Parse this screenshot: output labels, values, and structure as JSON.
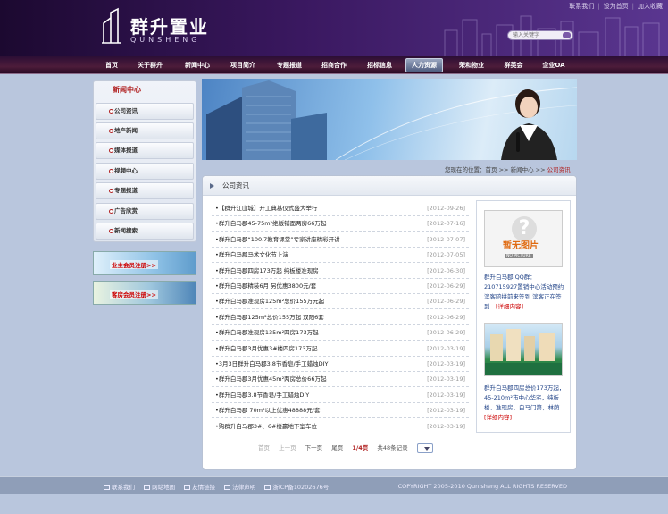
{
  "header": {
    "brand_cn": "群升置业",
    "brand_en": "QUNSHENG",
    "top_links": [
      "联系我们",
      "设为首页",
      "加入收藏"
    ],
    "search_placeholder": "输入关键字"
  },
  "nav": {
    "items": [
      "首页",
      "关于群升",
      "新闻中心",
      "项目简介",
      "专题报道",
      "招商合作",
      "招标信息",
      "人力资源",
      "荣和物业",
      "群英会",
      "企业OA"
    ],
    "active_index": 7
  },
  "sidebar": {
    "title": "新闻中心",
    "items": [
      "公司资讯",
      "地产新闻",
      "媒体报道",
      "视频中心",
      "专题报道",
      "广告欣赏",
      "新闻搜索"
    ]
  },
  "banners": [
    "业主会员注册>>",
    "客房会员注册>>"
  ],
  "breadcrumb": {
    "prefix": "您现在的位置：",
    "home": "首页",
    "sep": ">>",
    "section": "新闻中心",
    "current": "公司资讯"
  },
  "panel": {
    "title": "公司资讯",
    "news": [
      {
        "title": "•【群升江山城】开工典基仪式盛大举行",
        "date": "[2012-09-26]"
      },
      {
        "title": "•群升白马郡45-75m²绝版铺面两房66万起",
        "date": "[2012-07-16]"
      },
      {
        "title": "•群升白马郡“100.7教育课堂”专家讲座精彩开讲",
        "date": "[2012-07-07]"
      },
      {
        "title": "•群升白马郡马术文化节上演",
        "date": "[2012-07-05]"
      },
      {
        "title": "•群升白马郡四房173万起 纯板楼准现房",
        "date": "[2012-06-30]"
      },
      {
        "title": "•群升白马郡精装6月 另优惠3800元/套",
        "date": "[2012-06-29]"
      },
      {
        "title": "•群升白马郡准现房125m²总价155万元起",
        "date": "[2012-06-29]"
      },
      {
        "title": "•群升白马郡125m²总价155万起 双阳6套",
        "date": "[2012-06-29]"
      },
      {
        "title": "•群升白马郡准现房135m²四房173万起",
        "date": "[2012-06-29]"
      },
      {
        "title": "•群升白马郡3月优惠3#楼四房173万起",
        "date": "[2012-03-19]"
      },
      {
        "title": "•3月3日群升白马郡3.8节香皂/手工蜡烛DIY",
        "date": "[2012-03-19]"
      },
      {
        "title": "•群升白马郡3月优惠45m²两房总价66万起",
        "date": "[2012-03-19]"
      },
      {
        "title": "•群升白马郡3.8节香皂/手工蜡烛DIY",
        "date": "[2012-03-19]"
      },
      {
        "title": "•群升白马郡 70m²以上优惠48888元/套",
        "date": "[2012-03-19]"
      },
      {
        "title": "•购群升白马郡3#、6#楼赢地下室车位",
        "date": "[2012-03-19]"
      }
    ],
    "pager": {
      "first": "首页",
      "prev": "上一页",
      "next": "下一页",
      "last": "尾页",
      "page": "1/4页",
      "total": "共48条记录"
    }
  },
  "right": {
    "noimg_cn": "暂无图片",
    "noimg_en": "NO PICTURE",
    "text1": "群升白马郡 QQ群：210715927置销中心活动预约 滨客陪拼前来签到 滨客正在签到…",
    "more1": "[详细内容]",
    "text2": "群升白马郡四房总价173万起，45-210m²市中心华宅，纯板楼、准现房，白马门第，林荫…",
    "more2": "[详细内容]"
  },
  "footer": {
    "links": [
      "联系我们",
      "网站地图",
      "友情链接",
      "法律声明",
      "浙ICP备10202676号"
    ],
    "copyright": "COPYRIGHT 2005-2010 Qun sheng ALL RIGHTS RESERVED"
  },
  "colors": {
    "header_bg": "#3a1860",
    "nav_bg": "#4d1c3a",
    "accent_red": "#b02020",
    "page_bg": "#b9c6dd"
  }
}
